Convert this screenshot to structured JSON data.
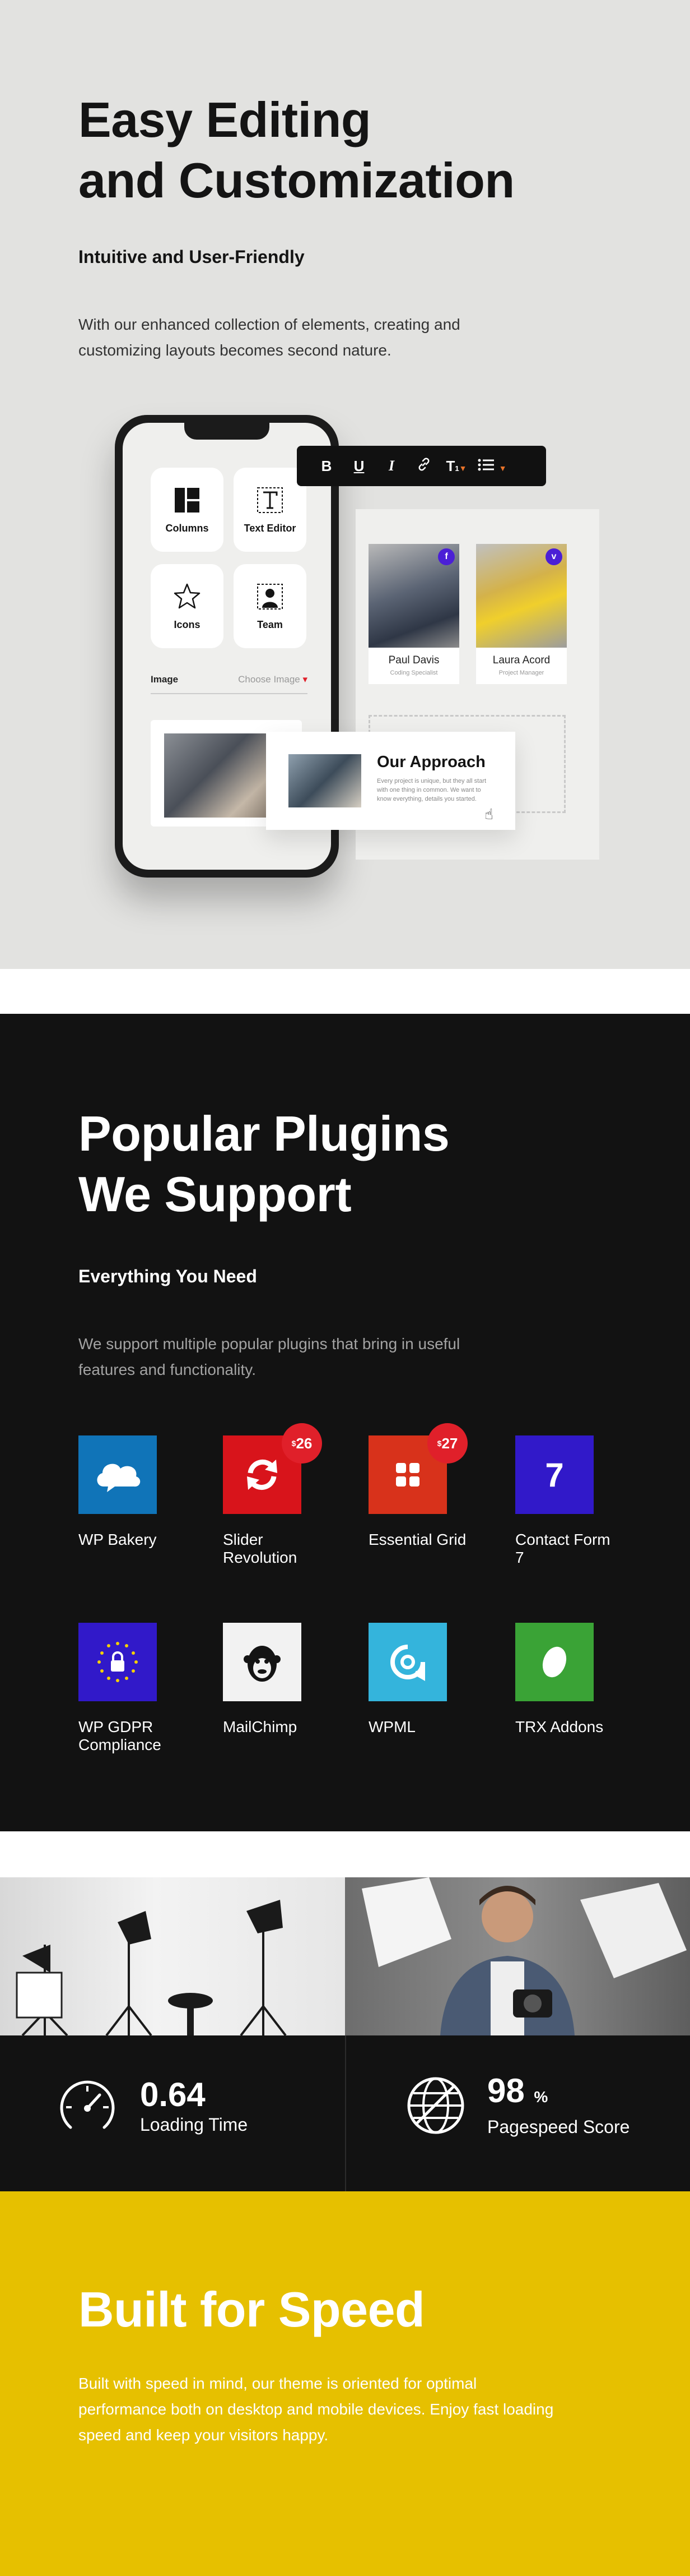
{
  "editing": {
    "title_line1": "Easy Editing",
    "title_line2": "and Customization",
    "subtitle": "Intuitive and User-Friendly",
    "description": "With our enhanced collection of elements, creating and customizing layouts becomes second nature.",
    "phone": {
      "tiles": [
        {
          "label": "Columns",
          "icon": "columns-icon"
        },
        {
          "label": "Text Editor",
          "icon": "text-editor-icon"
        },
        {
          "label": "Icons",
          "icon": "star-icon"
        },
        {
          "label": "Team",
          "icon": "team-icon"
        }
      ],
      "image_label": "Image",
      "image_action": "Choose Image"
    },
    "toolbar": {
      "bold": "B",
      "underline": "U",
      "italic": "I",
      "link_icon": "link-icon",
      "text_size": "T",
      "text_size_sub": "1",
      "list_icon": "list-icon"
    },
    "team": [
      {
        "name": "Paul Davis",
        "role": "Coding Specialist",
        "social": "f"
      },
      {
        "name": "Laura Acord",
        "role": "Project Manager",
        "social": "v"
      }
    ],
    "approach": {
      "title": "Our Approach",
      "text": "Every project is unique, but they all start with one thing in common. We want to know everything, details you started."
    }
  },
  "plugins": {
    "title_line1": "Popular Plugins",
    "title_line2": "We Support",
    "subtitle": "Everything You Need",
    "description": "We support multiple popular plugins that bring in useful features and functionality.",
    "items": [
      {
        "name": "WP Bakery",
        "color": "#1074b8",
        "icon": "cloud-icon"
      },
      {
        "name": "Slider Revolution",
        "color": "#d8141b",
        "icon": "refresh-icon",
        "price": "26",
        "currency": "$"
      },
      {
        "name": "Essential Grid",
        "color": "#d8321b",
        "icon": "grid-icon",
        "price": "27",
        "currency": "$"
      },
      {
        "name": "Contact Form 7",
        "color": "#3119c9",
        "icon": "seven-icon",
        "glyph": "7"
      },
      {
        "name": "WP GDPR Compliance",
        "color": "#3119c9",
        "icon": "lock-stars-icon"
      },
      {
        "name": "MailChimp",
        "color": "#f2f2f2",
        "icon": "chimp-icon"
      },
      {
        "name": "WPML",
        "color": "#34b4dc",
        "icon": "wpml-icon"
      },
      {
        "name": "TRX Addons",
        "color": "#3aa336",
        "icon": "leaf-icon"
      }
    ]
  },
  "stats": {
    "loading": {
      "value": "0.64",
      "label": "Loading Time",
      "icon": "speedometer-icon"
    },
    "pagespeed": {
      "value": "98",
      "unit": "%",
      "label": "Pagespeed Score",
      "icon": "globe-icon"
    }
  },
  "speed": {
    "title": "Built for Speed",
    "description": "Built with speed in mind, our theme is oriented for optimal performance both on desktop and mobile devices. Enjoy fast loading speed and keep your visitors happy."
  },
  "colors": {
    "accent_red": "#e0202a",
    "accent_yellow": "#e6c000",
    "dark_bg": "#121212",
    "light_bg": "#e2e2e0"
  }
}
